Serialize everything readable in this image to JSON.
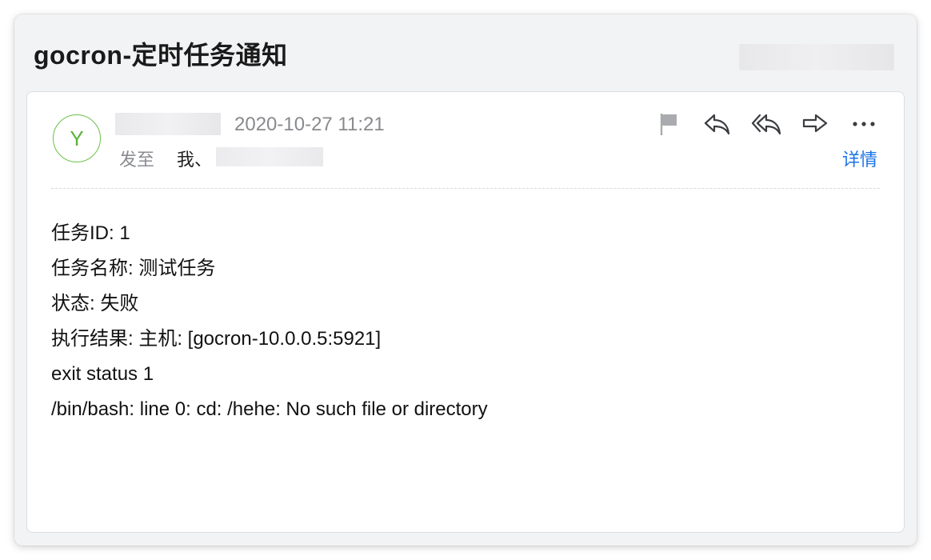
{
  "email": {
    "subject": "gocron-定时任务通知",
    "avatar_letter": "Y",
    "date": "2020-10-27 11:21",
    "to_label": "发至",
    "to_me": "我、",
    "details_label": "详情",
    "toolbar": {
      "icons": [
        "flag-icon",
        "reply-icon",
        "reply-all-icon",
        "forward-icon",
        "more-icon"
      ]
    },
    "body_lines": [
      "任务ID: 1",
      "任务名称: 测试任务",
      "状态: 失败",
      "执行结果: 主机: [gocron-10.0.0.5:5921]",
      "exit status 1",
      "/bin/bash: line 0: cd: /hehe: No such file or directory"
    ]
  },
  "colors": {
    "avatar": "#5db238",
    "link": "#1a73e8",
    "muted": "#888a8e",
    "background": "#f2f3f5"
  }
}
